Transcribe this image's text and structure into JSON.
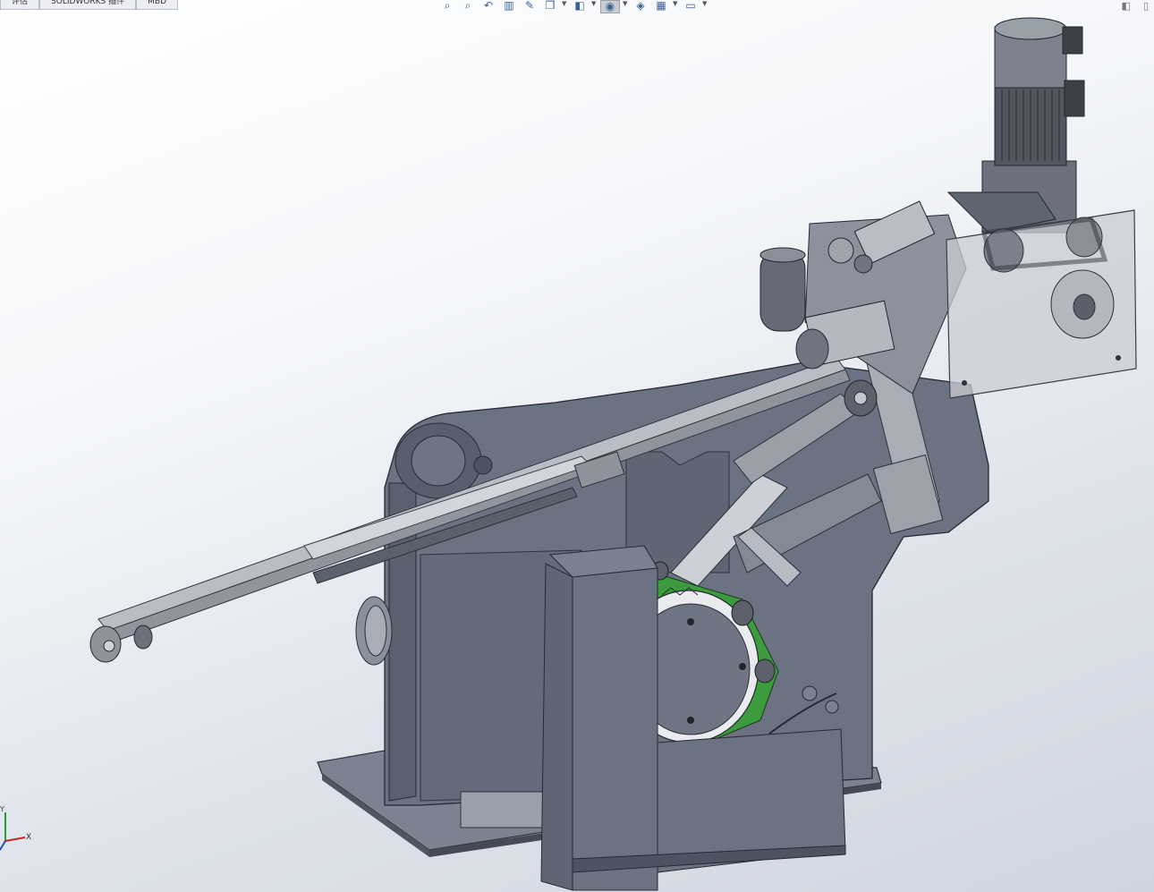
{
  "tabs": [
    {
      "label": "评估"
    },
    {
      "label": "SOLIDWORKS 插件"
    },
    {
      "label": "MBD"
    }
  ],
  "toolbar": [
    {
      "icon": "zoom-to-fit-icon",
      "glyph": "⌕"
    },
    {
      "icon": "zoom-to-area-icon",
      "glyph": "⌕"
    },
    {
      "icon": "previous-view-icon",
      "glyph": "↶"
    },
    {
      "icon": "section-view-icon",
      "glyph": "▥"
    },
    {
      "icon": "dynamic-annotation-icon",
      "glyph": "✎"
    },
    {
      "icon": "view-orientation-icon",
      "glyph": "❐"
    },
    {
      "icon": "display-style-icon",
      "glyph": "◧"
    },
    {
      "icon": "hide-show-items-icon",
      "glyph": "◉"
    },
    {
      "icon": "edit-appearance-icon",
      "glyph": "◈"
    },
    {
      "icon": "apply-scene-icon",
      "glyph": "▦"
    },
    {
      "icon": "view-settings-icon",
      "glyph": "▭"
    }
  ],
  "triad": {
    "x_label": "X",
    "y_label": "Y"
  },
  "colors": {
    "body": "#6b7281",
    "body_dark": "#4b5160",
    "steel": "#c7cbd2",
    "green": "#3c9b3c",
    "glass": "#c9ccd3"
  }
}
